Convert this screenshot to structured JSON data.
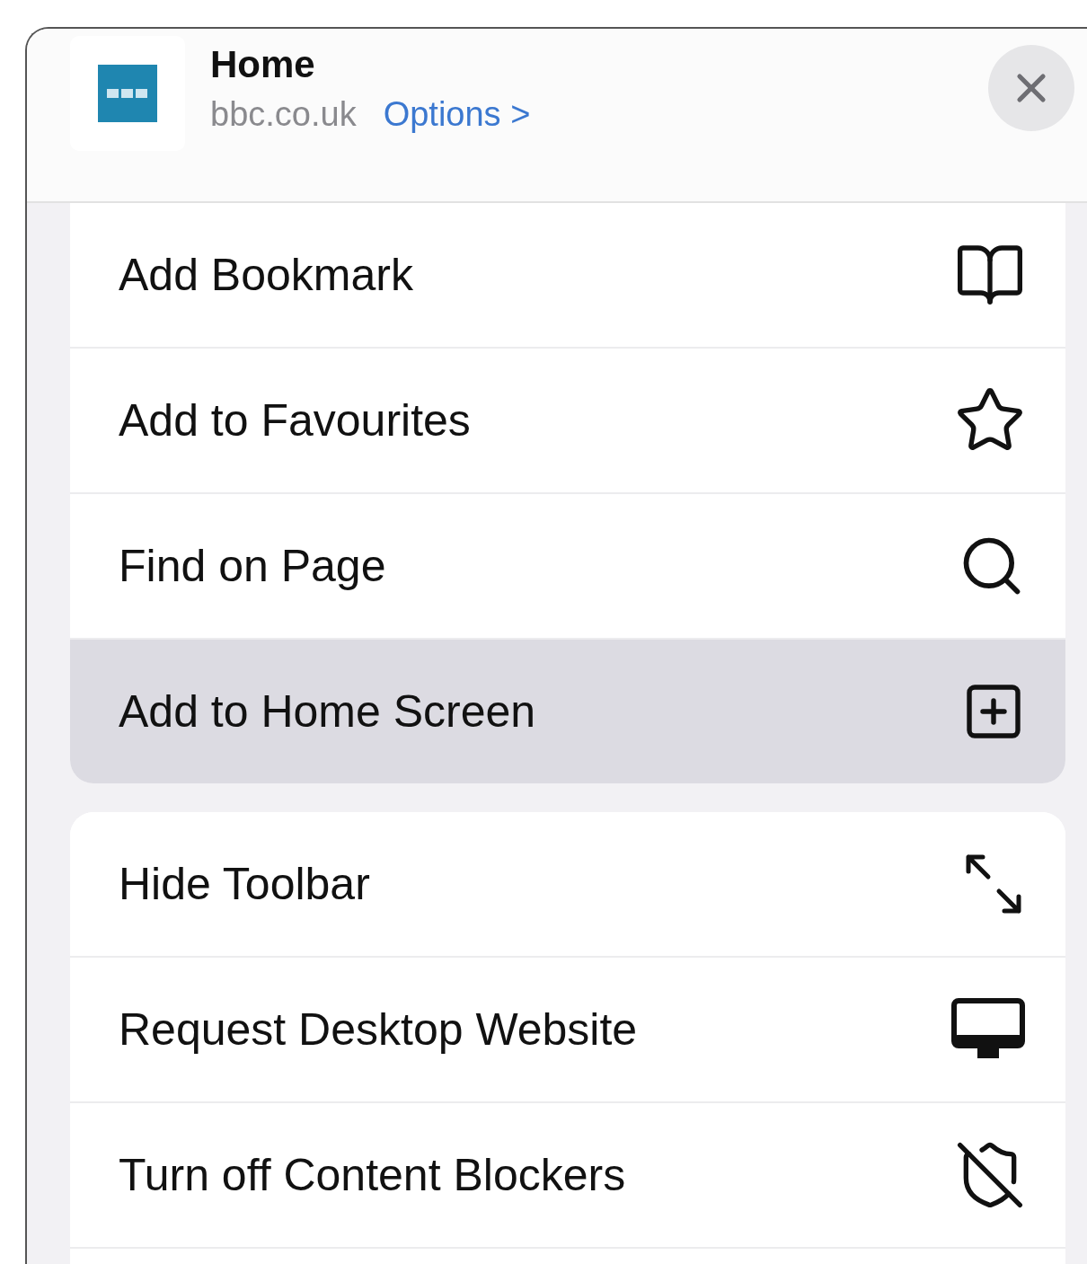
{
  "header": {
    "title": "Home",
    "domain": "bbc.co.uk",
    "options_link": "Options >"
  },
  "groups": [
    {
      "items": [
        {
          "label": "Add Bookmark",
          "selected": false
        },
        {
          "label": "Add to Favourites",
          "selected": false
        },
        {
          "label": "Find on Page",
          "selected": false
        },
        {
          "label": "Add to Home Screen",
          "selected": true
        }
      ]
    },
    {
      "items": [
        {
          "label": "Hide Toolbar",
          "selected": false
        },
        {
          "label": "Request Desktop Website",
          "selected": false
        },
        {
          "label": "Turn off Content Blockers",
          "selected": false
        }
      ]
    }
  ]
}
